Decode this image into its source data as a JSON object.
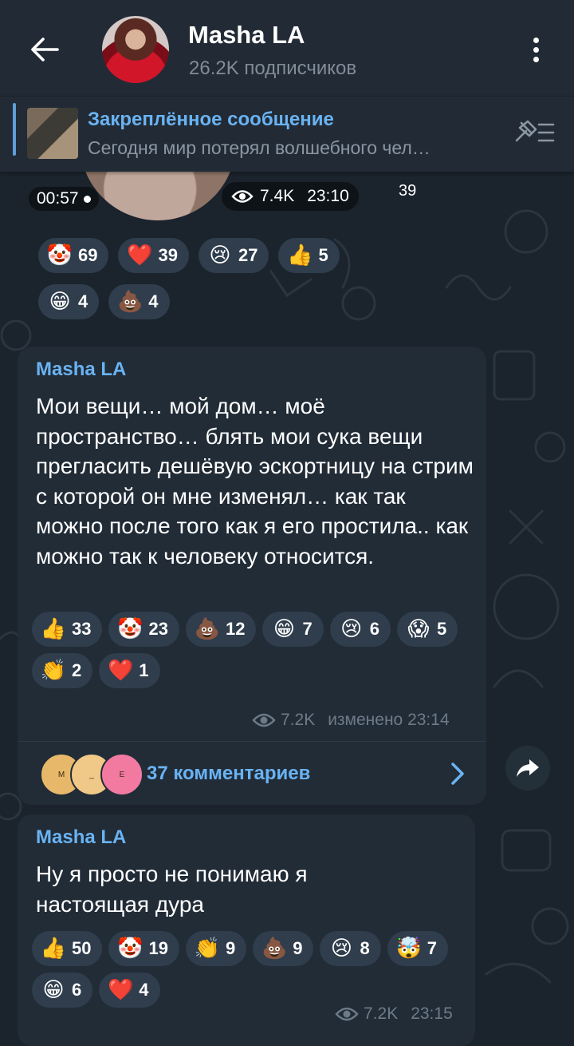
{
  "header": {
    "title": "Masha LA",
    "subtitle": "26.2K подписчиков"
  },
  "pinned": {
    "title": "Закреплённое сообщение",
    "text": "Сегодня мир потерял волшебного чел…"
  },
  "top_message": {
    "duration": "00:57",
    "views": "7.4K",
    "time": "23:10",
    "side_count": "39",
    "reactions": [
      {
        "icon": "clown-emoji",
        "emoji": "🤡",
        "count": "69"
      },
      {
        "icon": "heart-emoji",
        "emoji": "❤️",
        "count": "39"
      },
      {
        "icon": "crying-face-emoji",
        "emoji": "😢",
        "count": "27"
      },
      {
        "icon": "thumbs-up-emoji",
        "emoji": "👍",
        "count": "5"
      },
      {
        "icon": "grinning-face-emoji",
        "emoji": "😁",
        "count": "4"
      },
      {
        "icon": "poop-emoji",
        "emoji": "💩",
        "count": "4"
      }
    ]
  },
  "message1": {
    "author": "Masha LA",
    "text": "Мои вещи… мой дом… моё пространство… блять мои сука вещи прегласить дешёвую эскортницу на стрим с которой он мне изменял… как так можно после того как я его простила.. как можно так к человеку относится.",
    "views": "7.2K",
    "edited_time": "изменено 23:14",
    "comments_label": "37 комментариев",
    "commenter_initials": [
      "M",
      "_",
      "E"
    ],
    "reactions": [
      {
        "icon": "thumbs-up-emoji",
        "emoji": "👍",
        "count": "33"
      },
      {
        "icon": "clown-emoji",
        "emoji": "🤡",
        "count": "23"
      },
      {
        "icon": "poop-emoji",
        "emoji": "💩",
        "count": "12"
      },
      {
        "icon": "grinning-face-emoji",
        "emoji": "😁",
        "count": "7"
      },
      {
        "icon": "crying-face-emoji",
        "emoji": "😢",
        "count": "6"
      },
      {
        "icon": "screaming-face-emoji",
        "emoji": "😱",
        "count": "5"
      },
      {
        "icon": "clapping-hands-emoji",
        "emoji": "👏",
        "count": "2"
      },
      {
        "icon": "heart-emoji",
        "emoji": "❤️",
        "count": "1"
      }
    ]
  },
  "message2": {
    "author": "Masha LA",
    "text": "Ну я просто не понимаю я настоящая дура",
    "views": "7.2K",
    "time": "23:15",
    "reactions": [
      {
        "icon": "thumbs-up-emoji",
        "emoji": "👍",
        "count": "50"
      },
      {
        "icon": "clown-emoji",
        "emoji": "🤡",
        "count": "19"
      },
      {
        "icon": "clapping-hands-emoji",
        "emoji": "👏",
        "count": "9"
      },
      {
        "icon": "poop-emoji",
        "emoji": "💩",
        "count": "9"
      },
      {
        "icon": "crying-face-emoji",
        "emoji": "😢",
        "count": "8"
      },
      {
        "icon": "exploding-head-emoji",
        "emoji": "🤯",
        "count": "7"
      },
      {
        "icon": "grinning-face-emoji",
        "emoji": "😁",
        "count": "6"
      },
      {
        "icon": "heart-emoji",
        "emoji": "❤️",
        "count": "4"
      }
    ]
  },
  "colors": {
    "background": "#1b232c",
    "header": "#222b35",
    "bubble": "#212c37",
    "accent": "#6ab3f3",
    "chip": "#2f3d4c",
    "meta": "#6d7b88"
  }
}
